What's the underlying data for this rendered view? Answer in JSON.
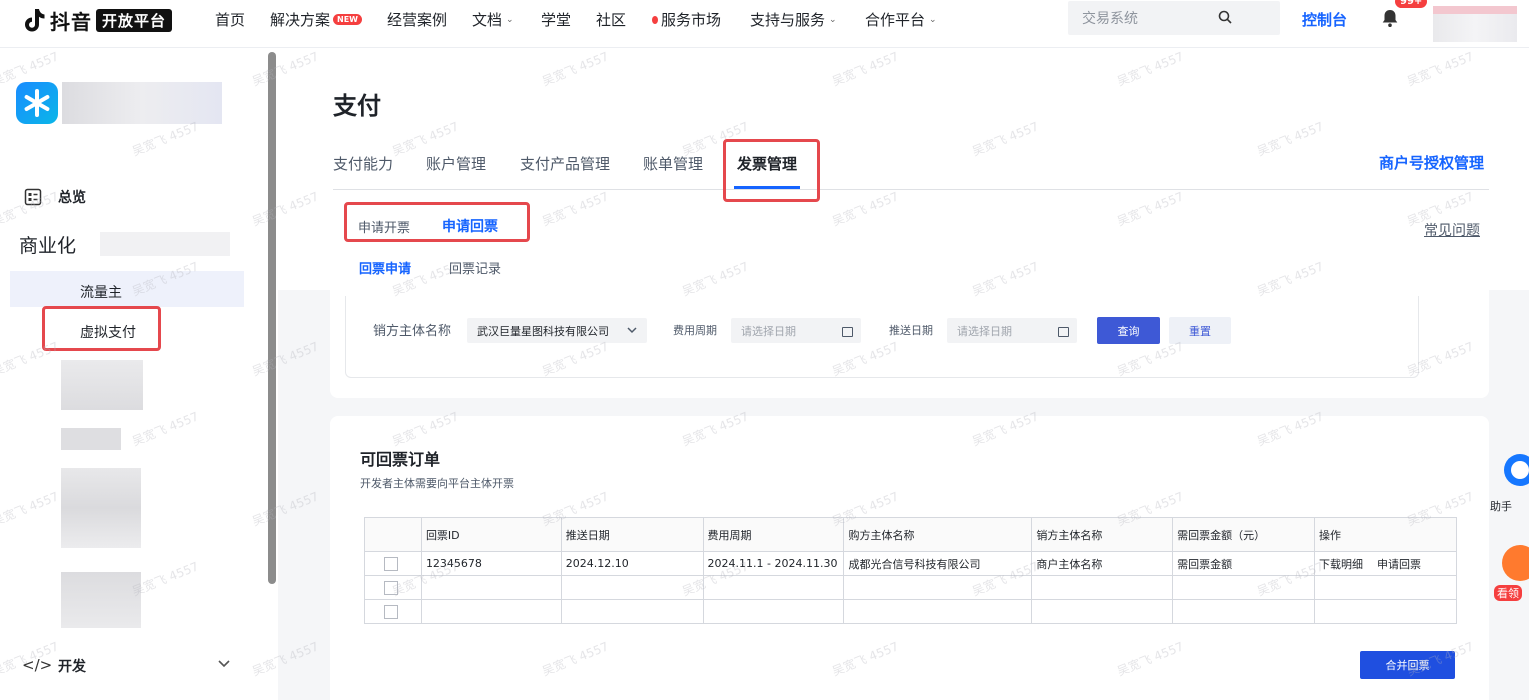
{
  "brand": {
    "logo_text": "抖音",
    "badge": "开放平台"
  },
  "nav": {
    "items": [
      {
        "label": "首页"
      },
      {
        "label": "解决方案",
        "badge": "NEW"
      },
      {
        "label": "经营案例"
      },
      {
        "label": "文档"
      },
      {
        "label": "学堂"
      },
      {
        "label": "社区"
      },
      {
        "label": "服务市场"
      },
      {
        "label": "支持与服务"
      },
      {
        "label": "合作平台"
      }
    ],
    "search_placeholder": "交易系统",
    "console": "控制台",
    "notification_count": "99+"
  },
  "sidebar": {
    "overview": "总览",
    "group": "商业化",
    "items": [
      {
        "label": "流量主"
      },
      {
        "label": "虚拟支付"
      }
    ],
    "dev": "开发"
  },
  "page": {
    "title": "支付",
    "tabs": [
      {
        "label": "支付能力"
      },
      {
        "label": "账户管理"
      },
      {
        "label": "支付产品管理"
      },
      {
        "label": "账单管理"
      },
      {
        "label": "发票管理"
      }
    ],
    "merchant_link": "商户号授权管理",
    "subtabs": [
      {
        "label": "申请开票"
      },
      {
        "label": "申请回票"
      }
    ],
    "faq": "常见问题",
    "subsubtabs": [
      {
        "label": "回票申请"
      },
      {
        "label": "回票记录"
      }
    ]
  },
  "filter": {
    "seller_label": "销方主体名称",
    "seller_value": "武汉巨量星图科技有限公司",
    "period_label": "费用周期",
    "period_placeholder": "请选择日期",
    "push_label": "推送日期",
    "push_placeholder": "请选择日期",
    "query": "查询",
    "reset": "重置"
  },
  "table_card": {
    "title": "可回票订单",
    "subtitle": "开发者主体需要向平台主体开票",
    "columns": [
      "回票ID",
      "推送日期",
      "费用周期",
      "购方主体名称",
      "销方主体名称",
      "需回票金额（元）",
      "操作"
    ],
    "rows": [
      {
        "id": "12345678",
        "push_date": "2024.12.10",
        "period": "2024.11.1 - 2024.11.30",
        "buyer": "成都光合信号科技有限公司",
        "seller": "商户主体名称",
        "amount": "需回票金额",
        "op1": "下载明细",
        "op2": "申请回票"
      }
    ],
    "merge_button": "合并回票"
  },
  "floating": {
    "assistant": "助手",
    "claim": "看领"
  },
  "watermark": "吴宽飞 4557"
}
